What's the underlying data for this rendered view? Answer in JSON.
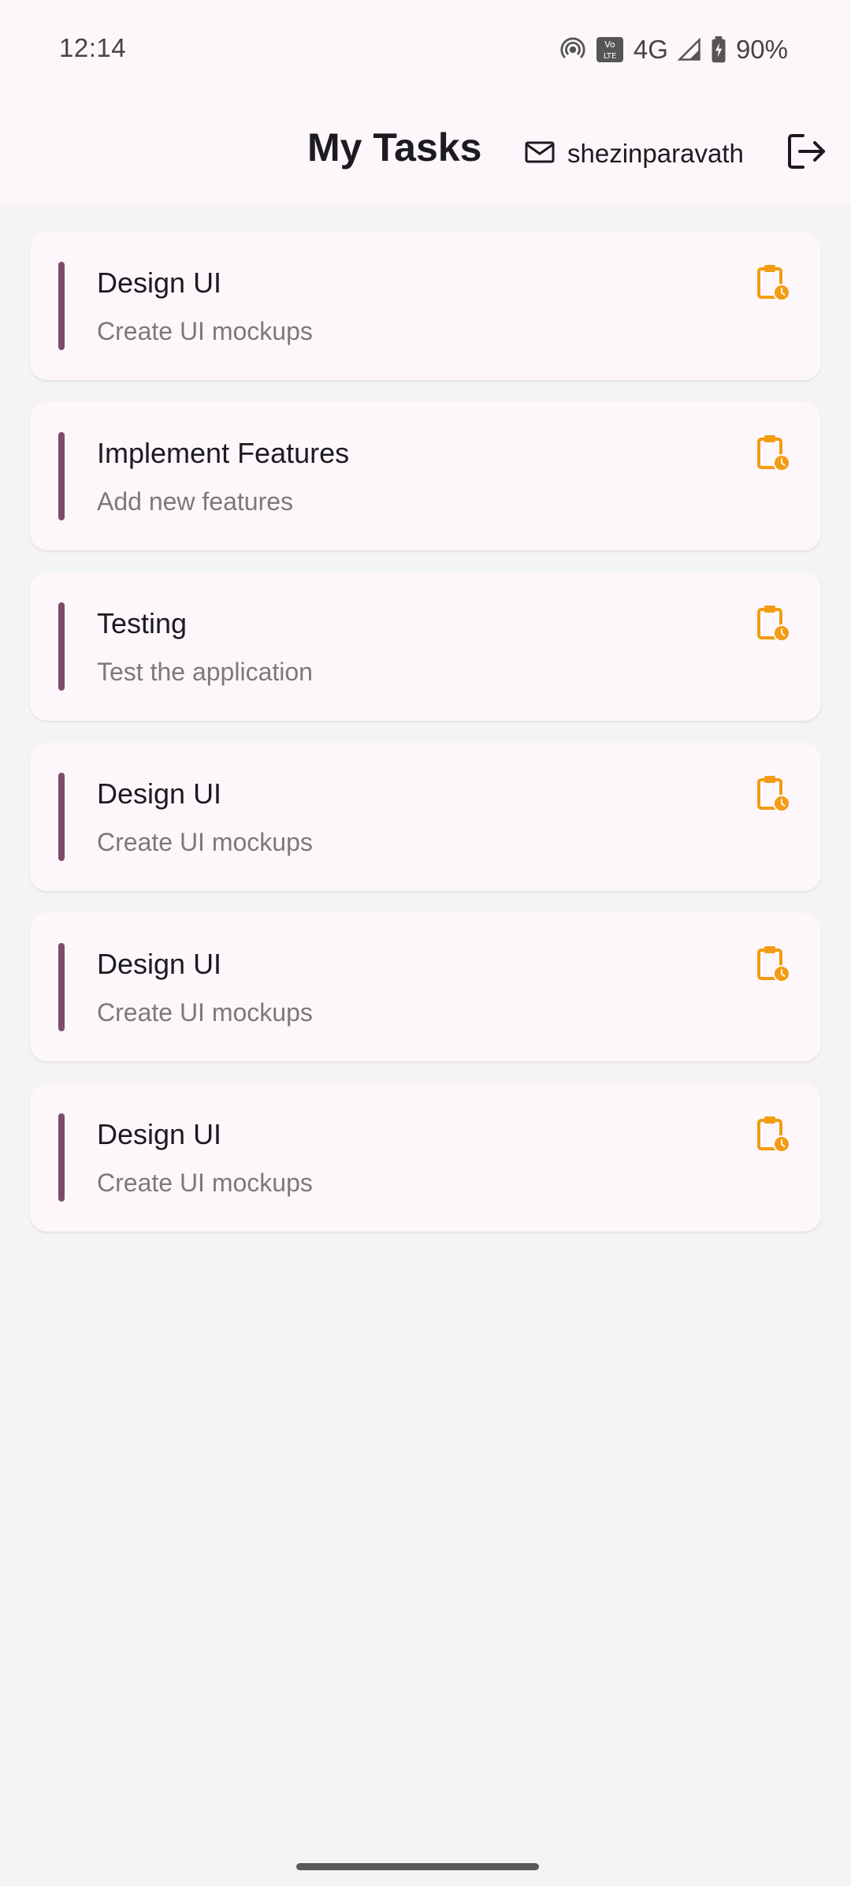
{
  "status_bar": {
    "time": "12:14",
    "network": "4G",
    "battery": "90%",
    "icons": [
      "hotspot-icon",
      "volte-icon",
      "signal-icon",
      "battery-charging-icon"
    ]
  },
  "header": {
    "title": "My Tasks",
    "user_name": "shezinparavath",
    "icons": [
      "mail-icon",
      "logout-icon"
    ]
  },
  "tasks": [
    {
      "title": "Design UI",
      "subtitle": "Create UI mockups",
      "icon": "clipboard-clock-icon"
    },
    {
      "title": "Implement Features",
      "subtitle": "Add new features",
      "icon": "clipboard-clock-icon"
    },
    {
      "title": "Testing",
      "subtitle": "Test the application",
      "icon": "clipboard-clock-icon"
    },
    {
      "title": "Design UI",
      "subtitle": "Create UI mockups",
      "icon": "clipboard-clock-icon"
    },
    {
      "title": "Design UI",
      "subtitle": "Create UI mockups",
      "icon": "clipboard-clock-icon"
    },
    {
      "title": "Design UI",
      "subtitle": "Create UI mockups",
      "icon": "clipboard-clock-icon"
    }
  ],
  "colors": {
    "accent_bar": "#7d4d68",
    "pending_icon": "#f39c12",
    "card_bg": "#fdf7fc",
    "page_bg": "#f4f4f4"
  }
}
